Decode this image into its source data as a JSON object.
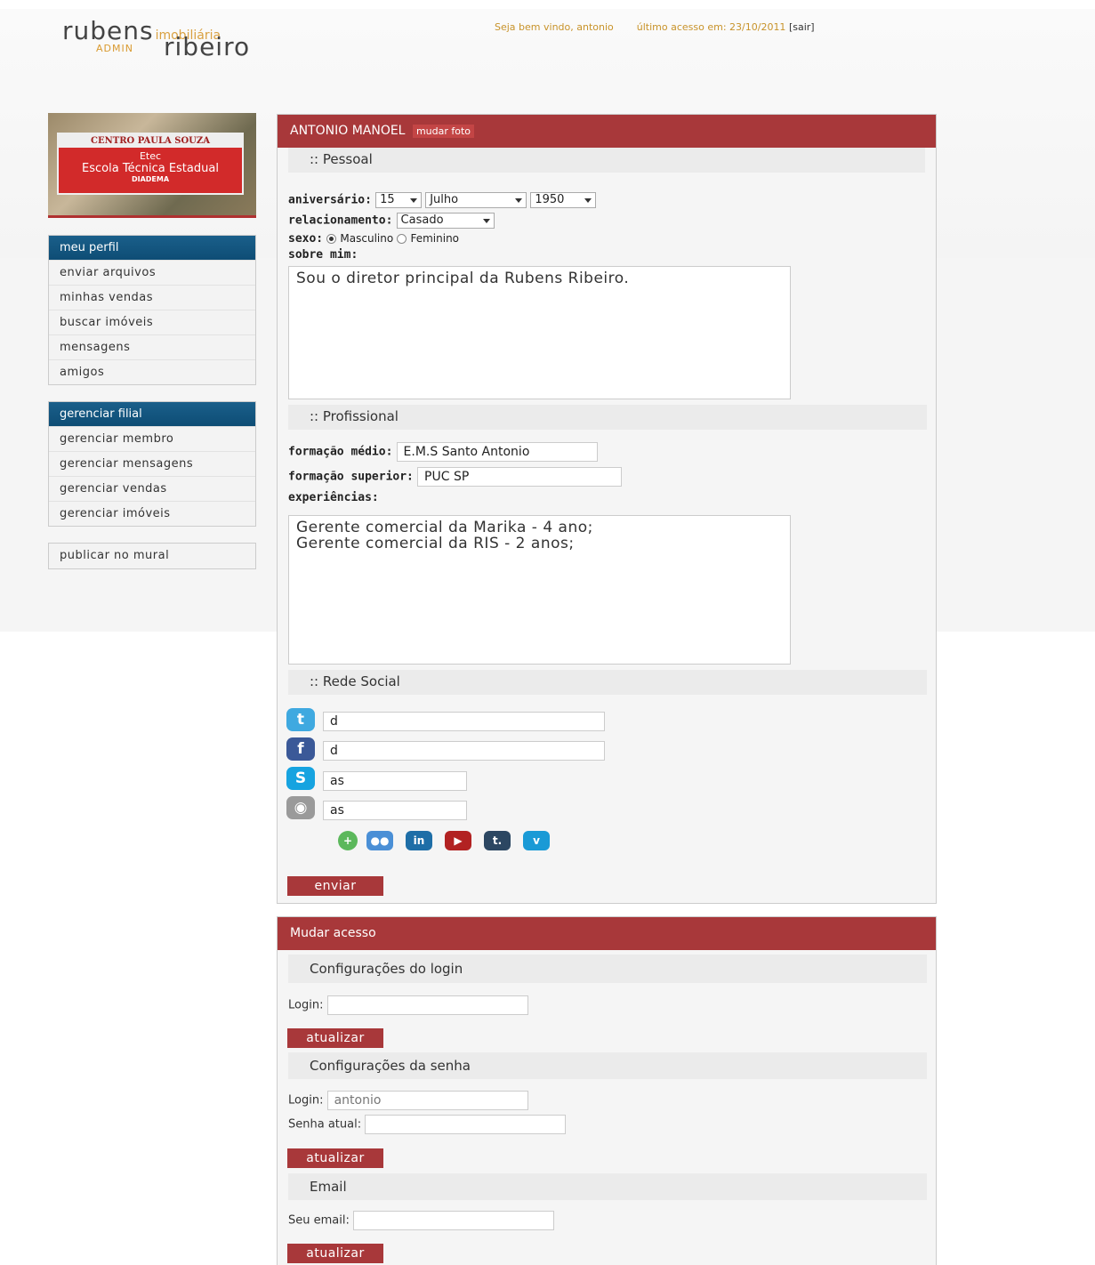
{
  "header": {
    "logo_rubens": "rubens",
    "logo_imob": "imobiliária",
    "logo_admin": "ADMIN",
    "logo_ribeiro": "ribeiro",
    "welcome": "Seja bem vindo, antonio",
    "last_access": "último acesso em: 23/10/2011",
    "logout": "[sair]"
  },
  "sidebar": {
    "photo_sign": [
      "CENTRO PAULA SOUZA",
      "Etec",
      "Escola Técnica Estadual",
      "DIADEMA"
    ],
    "menu1": {
      "head": "meu perfil",
      "items": [
        "enviar arquivos",
        "minhas vendas",
        "buscar imóveis",
        "mensagens",
        "amigos"
      ]
    },
    "menu2": {
      "head": "gerenciar filial",
      "items": [
        "gerenciar membro",
        "gerenciar mensagens",
        "gerenciar vendas",
        "gerenciar imóveis"
      ]
    },
    "menu3": {
      "items": [
        "publicar no mural"
      ]
    }
  },
  "profile": {
    "name": "ANTONIO MANOEL",
    "change_photo": "mudar foto",
    "sections": {
      "personal": ":: Pessoal",
      "professional": ":: Profissional",
      "social": ":: Rede Social"
    },
    "birthday_label": "aniversário:",
    "birthday_day": "15",
    "birthday_month": "Julho",
    "birthday_year": "1950",
    "relationship_label": "relacionamento:",
    "relationship_value": "Casado",
    "sex_label": "sexo:",
    "sex_male": "Masculino",
    "sex_female": "Feminino",
    "about_label": "sobre mim:",
    "about_text": "Sou o diretor principal da Rubens Ribeiro.",
    "edu_mid_label": "formação médio:",
    "edu_mid_value": "E.M.S Santo Antonio",
    "edu_high_label": "formação superior:",
    "edu_high_value": "PUC SP",
    "exp_label": "experiências:",
    "exp_text": "Gerente comercial da Marika - 4 ano;\nGerente comercial da RIS - 2 anos;",
    "social": {
      "twitter": "d",
      "facebook": "d",
      "skype": "as",
      "picasa": "as"
    },
    "submit": "enviar"
  },
  "access": {
    "title": "Mudar acesso",
    "login_section": "Configurações do login",
    "login_label": "Login:",
    "login_value": "",
    "update1": "atualizar",
    "password_section": "Configurações da senha",
    "pw_login_label": "Login:",
    "pw_login_value": "antonio",
    "current_pw_label": "Senha atual:",
    "current_pw_value": "",
    "update2": "atualizar",
    "email_section": "Email",
    "email_label": "Seu email:",
    "email_value": "",
    "update3": "atualizar"
  },
  "colors": {
    "brand_red": "#a8383a",
    "menu_blue": "#0e4d75",
    "accent_gold": "#c8932a"
  }
}
